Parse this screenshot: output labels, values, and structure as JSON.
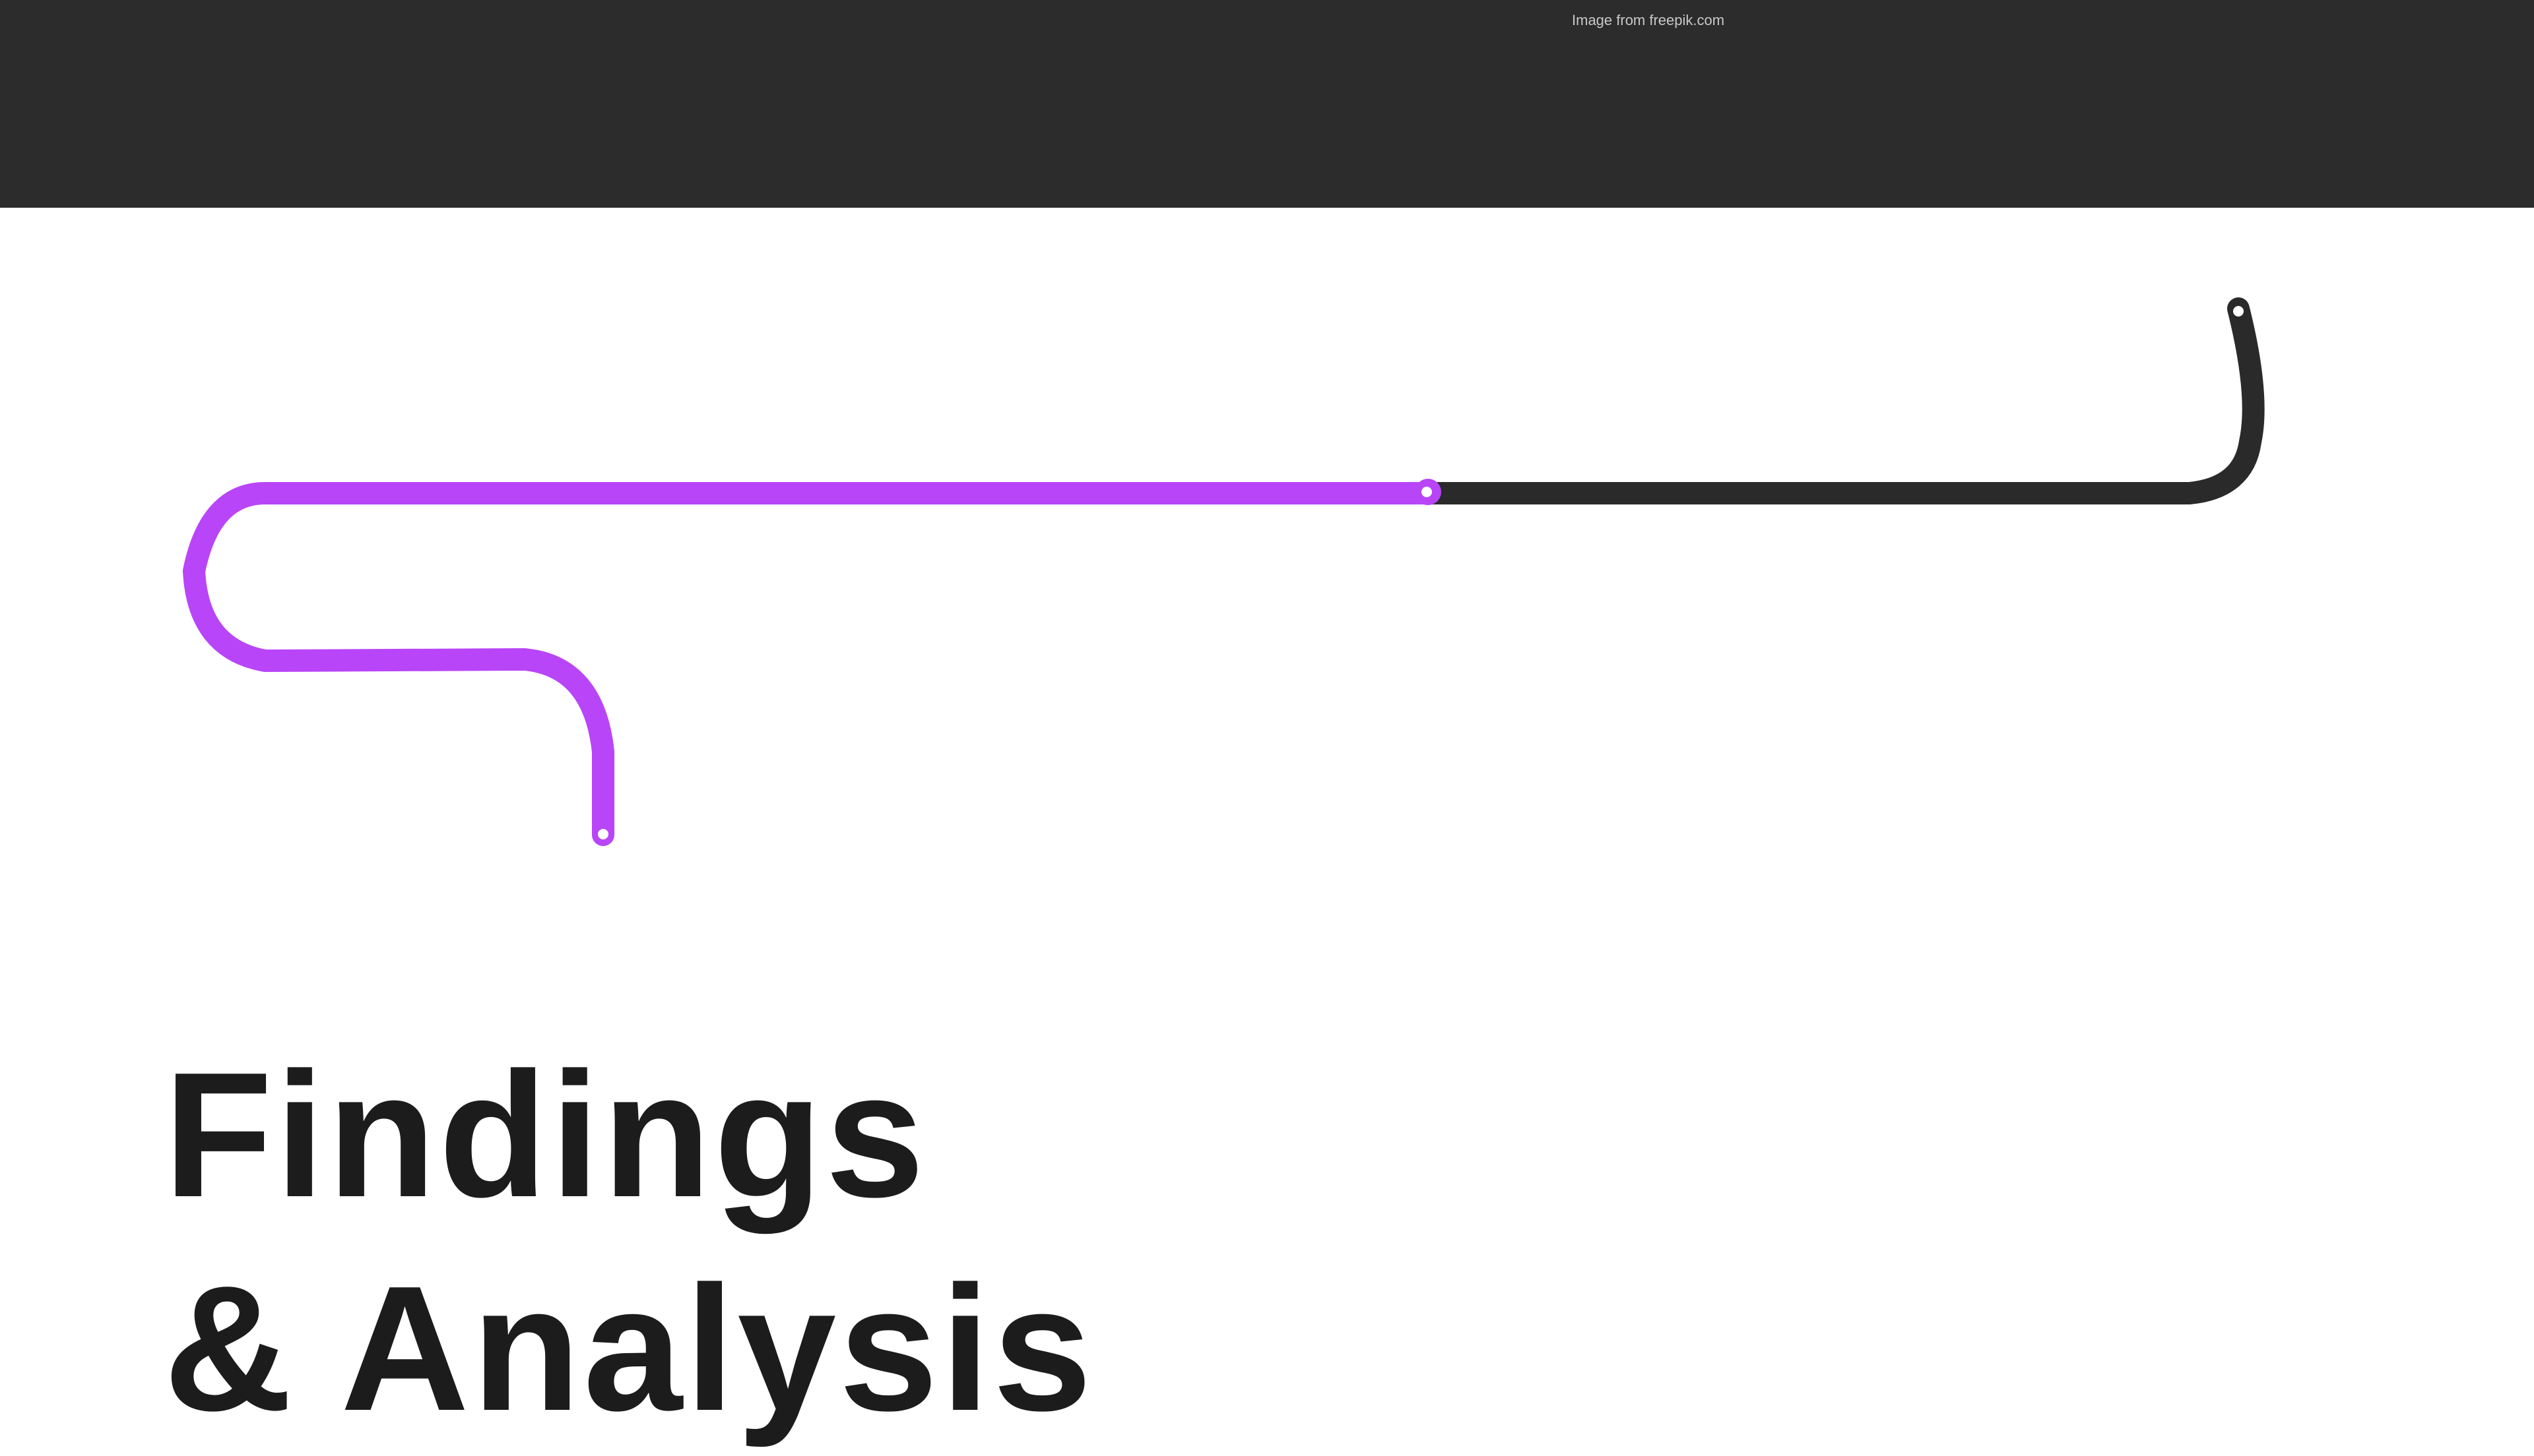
{
  "header": {
    "credit": "Image from freepik.com"
  },
  "title": {
    "line1": "Findings",
    "line2": "& Analysis"
  },
  "colors": {
    "band": "#2c2c2c",
    "accent": "#b845f7",
    "track": "#2a2a2a",
    "text": "#1c1c1c"
  },
  "progress": {
    "accent_fraction": 0.55
  }
}
